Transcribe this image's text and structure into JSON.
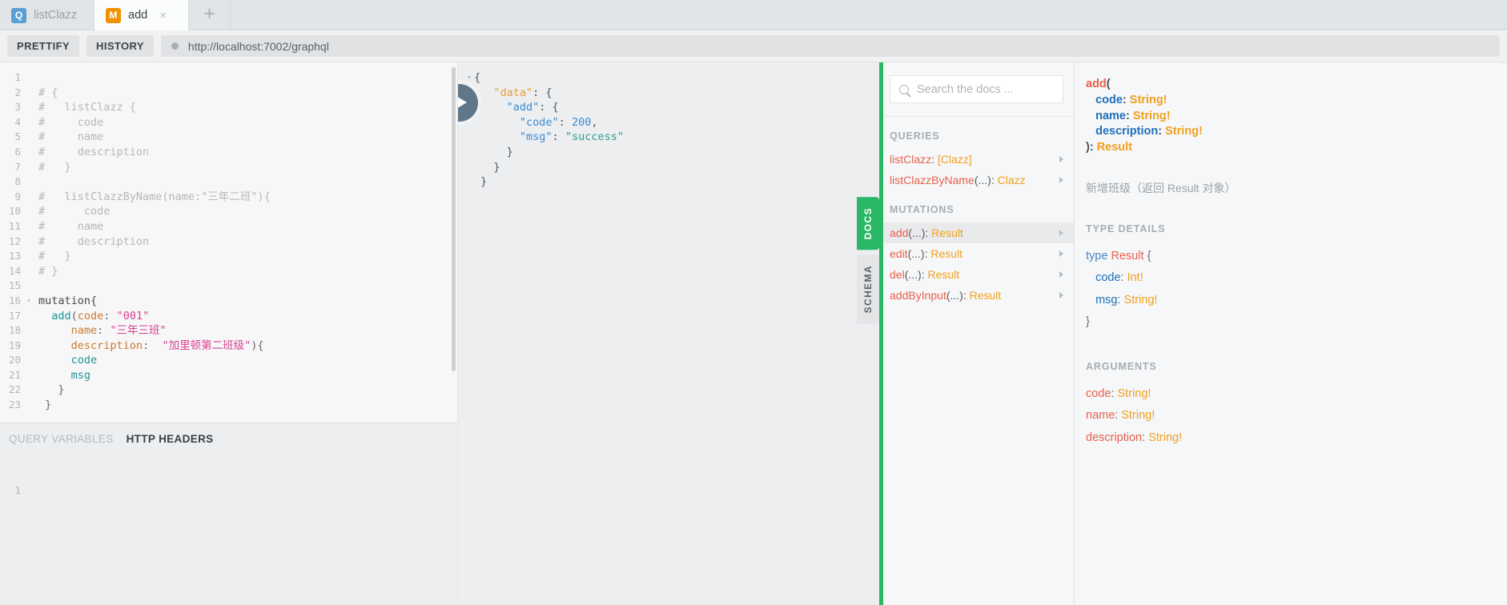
{
  "tabs": [
    {
      "badge": "Q",
      "badge_kind": "q",
      "label": "listClazz",
      "active": false,
      "closable": false
    },
    {
      "badge": "M",
      "badge_kind": "m",
      "label": "add",
      "active": true,
      "closable": true,
      "close_glyph": "×"
    }
  ],
  "tab_add_glyph": "+",
  "toolbar": {
    "prettify_label": "PRETTIFY",
    "history_label": "HISTORY",
    "url": "http://localhost:7002/graphql"
  },
  "editor": {
    "lines": [
      {
        "n": "1",
        "fold": "",
        "parts": []
      },
      {
        "n": "2",
        "fold": "",
        "parts": [
          {
            "c": "cm-comment",
            "t": "# {"
          }
        ]
      },
      {
        "n": "3",
        "fold": "",
        "parts": [
          {
            "c": "cm-comment",
            "t": "#   listClazz {"
          }
        ]
      },
      {
        "n": "4",
        "fold": "",
        "parts": [
          {
            "c": "cm-comment",
            "t": "#     code"
          }
        ]
      },
      {
        "n": "5",
        "fold": "",
        "parts": [
          {
            "c": "cm-comment",
            "t": "#     name"
          }
        ]
      },
      {
        "n": "6",
        "fold": "",
        "parts": [
          {
            "c": "cm-comment",
            "t": "#     description"
          }
        ]
      },
      {
        "n": "7",
        "fold": "",
        "parts": [
          {
            "c": "cm-comment",
            "t": "#   }"
          }
        ]
      },
      {
        "n": "8",
        "fold": "",
        "parts": []
      },
      {
        "n": "9",
        "fold": "",
        "parts": [
          {
            "c": "cm-comment",
            "t": "#   listClazzByName(name:\"三年二班\"){"
          }
        ]
      },
      {
        "n": "10",
        "fold": "",
        "parts": [
          {
            "c": "cm-comment",
            "t": "#      code"
          }
        ]
      },
      {
        "n": "11",
        "fold": "",
        "parts": [
          {
            "c": "cm-comment",
            "t": "#     name"
          }
        ]
      },
      {
        "n": "12",
        "fold": "",
        "parts": [
          {
            "c": "cm-comment",
            "t": "#     description"
          }
        ]
      },
      {
        "n": "13",
        "fold": "",
        "parts": [
          {
            "c": "cm-comment",
            "t": "#   }"
          }
        ]
      },
      {
        "n": "14",
        "fold": "",
        "parts": [
          {
            "c": "cm-comment",
            "t": "# }"
          }
        ]
      },
      {
        "n": "15",
        "fold": "",
        "parts": []
      },
      {
        "n": "16",
        "fold": "▾",
        "parts": [
          {
            "c": "cm-keyword",
            "t": "mutation{"
          }
        ]
      },
      {
        "n": "17",
        "fold": "",
        "parts": [
          {
            "c": "cm-def",
            "t": "  add"
          },
          {
            "c": "cm-punct",
            "t": "("
          },
          {
            "c": "cm-attr",
            "t": "code"
          },
          {
            "c": "cm-punct",
            "t": ": "
          },
          {
            "c": "cm-string",
            "t": "\"001\""
          }
        ]
      },
      {
        "n": "18",
        "fold": "",
        "parts": [
          {
            "c": "cm-attr",
            "t": "     name"
          },
          {
            "c": "cm-punct",
            "t": ": "
          },
          {
            "c": "cm-string",
            "t": "\"三年三班\""
          }
        ]
      },
      {
        "n": "19",
        "fold": "",
        "parts": [
          {
            "c": "cm-attr",
            "t": "     description"
          },
          {
            "c": "cm-punct",
            "t": ":  "
          },
          {
            "c": "cm-string",
            "t": "\"加里顿第二班级\""
          },
          {
            "c": "cm-punct",
            "t": "){"
          }
        ]
      },
      {
        "n": "20",
        "fold": "",
        "parts": [
          {
            "c": "cm-prop",
            "t": "     code"
          }
        ]
      },
      {
        "n": "21",
        "fold": "",
        "parts": [
          {
            "c": "cm-prop",
            "t": "     msg"
          }
        ]
      },
      {
        "n": "22",
        "fold": "",
        "parts": [
          {
            "c": "cm-punct",
            "t": "   }"
          }
        ]
      },
      {
        "n": "23",
        "fold": "",
        "parts": [
          {
            "c": "cm-punct",
            "t": " }"
          }
        ]
      }
    ]
  },
  "variables": {
    "tabs": [
      {
        "label": "QUERY VARIABLES",
        "active": false
      },
      {
        "label": "HTTP HEADERS",
        "active": true
      }
    ],
    "line_number": "1",
    "content": ""
  },
  "result": {
    "execute_icon": "play-icon",
    "lines": [
      {
        "fold": "▾",
        "parts": [
          {
            "c": "json-punct",
            "t": "{"
          }
        ]
      },
      {
        "fold": "▾",
        "parts": [
          {
            "c": "json-key-o",
            "t": "   \"data\""
          },
          {
            "c": "json-punct",
            "t": ": {"
          }
        ]
      },
      {
        "fold": "",
        "parts": [
          {
            "c": "json-key",
            "t": "     \"add\""
          },
          {
            "c": "json-punct",
            "t": ": {"
          }
        ]
      },
      {
        "fold": "",
        "parts": [
          {
            "c": "json-key",
            "t": "       \"code\""
          },
          {
            "c": "json-punct",
            "t": ": "
          },
          {
            "c": "json-num",
            "t": "200"
          },
          {
            "c": "json-punct",
            "t": ","
          }
        ]
      },
      {
        "fold": "",
        "parts": [
          {
            "c": "json-key",
            "t": "       \"msg\""
          },
          {
            "c": "json-punct",
            "t": ": "
          },
          {
            "c": "json-str",
            "t": "\"success\""
          }
        ]
      },
      {
        "fold": "",
        "parts": [
          {
            "c": "json-punct",
            "t": "     }"
          }
        ]
      },
      {
        "fold": "",
        "parts": [
          {
            "c": "json-punct",
            "t": "   }"
          }
        ]
      },
      {
        "fold": "",
        "parts": [
          {
            "c": "json-punct",
            "t": " }"
          }
        ]
      }
    ]
  },
  "side_tabs": [
    {
      "label": "DOCS",
      "active": true
    },
    {
      "label": "SCHEMA",
      "active": false
    }
  ],
  "docs": {
    "search_placeholder": "Search the docs ...",
    "sections": [
      {
        "heading": "QUERIES",
        "rows": [
          {
            "field": "listClazz",
            "args": "",
            "sep": ": ",
            "type": "[Clazz]",
            "selected": false
          },
          {
            "field": "listClazzByName",
            "args": "(...)",
            "sep": ": ",
            "type": "Clazz",
            "selected": false
          }
        ]
      },
      {
        "heading": "MUTATIONS",
        "rows": [
          {
            "field": "add",
            "args": "(...)",
            "sep": ": ",
            "type": "Result",
            "selected": true
          },
          {
            "field": "edit",
            "args": "(...)",
            "sep": ": ",
            "type": "Result",
            "selected": false
          },
          {
            "field": "del",
            "args": "(...)",
            "sep": ": ",
            "type": "Result",
            "selected": false
          },
          {
            "field": "addByInput",
            "args": "(...)",
            "sep": ": ",
            "type": "Result",
            "selected": false
          }
        ]
      }
    ]
  },
  "detail": {
    "signature": [
      {
        "parts": [
          {
            "c": "s-name",
            "t": "add"
          },
          {
            "c": "s-punct",
            "t": "("
          }
        ]
      },
      {
        "parts": [
          {
            "c": "s-arg",
            "t": "   code"
          },
          {
            "c": "s-punct",
            "t": ": "
          },
          {
            "c": "s-type",
            "t": "String!"
          }
        ]
      },
      {
        "parts": [
          {
            "c": "s-arg",
            "t": "   name"
          },
          {
            "c": "s-punct",
            "t": ": "
          },
          {
            "c": "s-type",
            "t": "String!"
          }
        ]
      },
      {
        "parts": [
          {
            "c": "s-arg",
            "t": "   description"
          },
          {
            "c": "s-punct",
            "t": ": "
          },
          {
            "c": "s-type",
            "t": "String!"
          }
        ]
      },
      {
        "parts": [
          {
            "c": "s-punct",
            "t": "): "
          },
          {
            "c": "s-type",
            "t": "Result"
          }
        ]
      }
    ],
    "description": "新增班级（返回 Result 对象）",
    "type_details_heading": "TYPE DETAILS",
    "type_details": [
      {
        "parts": [
          {
            "c": "t-kw",
            "t": "type "
          },
          {
            "c": "t-name",
            "t": "Result"
          },
          {
            "c": "t-punct",
            "t": " {"
          }
        ]
      },
      {
        "parts": [
          {
            "c": "t-field",
            "t": "   code"
          },
          {
            "c": "t-punct",
            "t": ": "
          },
          {
            "c": "t-type",
            "t": "Int!"
          }
        ]
      },
      {
        "parts": [
          {
            "c": "t-field",
            "t": "   msg"
          },
          {
            "c": "t-punct",
            "t": ": "
          },
          {
            "c": "t-type",
            "t": "String!"
          }
        ]
      },
      {
        "parts": [
          {
            "c": "t-punct",
            "t": "}"
          }
        ]
      }
    ],
    "arguments_heading": "ARGUMENTS",
    "arguments": [
      {
        "name": "code",
        "sep": ": ",
        "type": "String!"
      },
      {
        "name": "name",
        "sep": ": ",
        "type": "String!"
      },
      {
        "name": "description",
        "sep": ": ",
        "type": "String!"
      }
    ]
  }
}
